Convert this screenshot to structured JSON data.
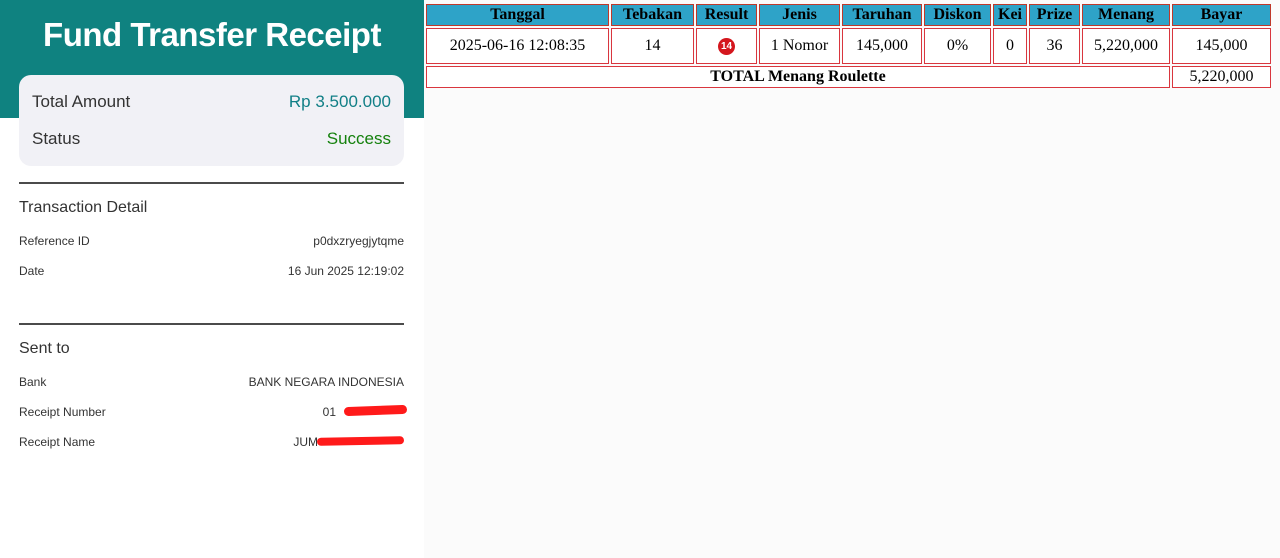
{
  "receipt": {
    "title": "Fund Transfer Receipt",
    "summary": {
      "total_amount_label": "Total Amount",
      "total_amount_value": "Rp 3.500.000",
      "status_label": "Status",
      "status_value": "Success"
    },
    "transaction_detail": {
      "title": "Transaction Detail",
      "reference_label": "Reference ID",
      "reference_value": "p0dxzryegjytqme",
      "date_label": "Date",
      "date_value": "16 Jun 2025 12:19:02"
    },
    "sent_to": {
      "title": "Sent to",
      "bank_label": "Bank",
      "bank_value": "BANK NEGARA INDONESIA",
      "receipt_number_label": "Receipt Number",
      "receipt_number_value": "01",
      "receipt_name_label": "Receipt Name",
      "receipt_name_value": "JUM"
    },
    "colors": {
      "header": "#0f8280",
      "amount": "#117f86",
      "status": "#15810d",
      "redaction": "#ff1a1a"
    }
  },
  "bet_table": {
    "headers": [
      "Tanggal",
      "Tebakan",
      "Result",
      "Jenis",
      "Taruhan",
      "Diskon",
      "Kei",
      "Prize",
      "Menang",
      "Bayar"
    ],
    "row": {
      "tanggal": "2025-06-16 12:08:35",
      "tebakan": "14",
      "result": "14",
      "jenis": "1 Nomor",
      "taruhan": "145,000",
      "diskon": "0%",
      "kei": "0",
      "prize": "36",
      "menang": "5,220,000",
      "bayar": "145,000"
    },
    "total_label": "TOTAL  Menang Roulette",
    "total_value": "5,220,000",
    "colors": {
      "header_bg": "#2ea3c8",
      "border": "#d9363e",
      "result_ball": "#d4161d"
    }
  }
}
